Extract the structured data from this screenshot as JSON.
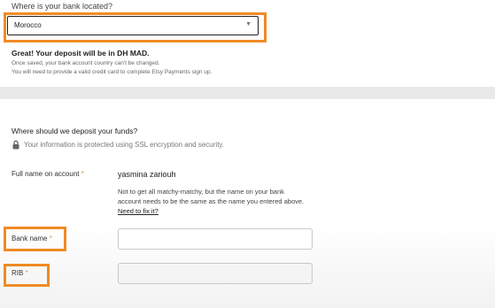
{
  "country": {
    "label": "Where is your bank located?",
    "selected": "Morocco",
    "chevron_icon": "chevron-down-icon"
  },
  "deposit_notice": {
    "headline": "Great! Your deposit will be in DH MAD.",
    "line1": "Once saved, your bank account country can't be changed.",
    "line2": "You will need to provide a valid credit card to complete Etsy Payments sign up."
  },
  "deposit": {
    "title": "Where should we deposit your funds?",
    "security_note": "Your information is protected using SSL encryption and security.",
    "lock_icon": "lock-icon"
  },
  "full_name": {
    "label": "Full name on account",
    "required_mark": "*",
    "value": "yasmina zariouh",
    "hint_line1": "Not to get all matchy-matchy, but the name on your bank",
    "hint_line2": "account needs to be the same as the name you entered above.",
    "fix_link": "Need to fix it?"
  },
  "bank_name": {
    "label": "Bank name",
    "required_mark": "*",
    "value": ""
  },
  "rib": {
    "label": "RIB",
    "required_mark": "*",
    "value": ""
  },
  "colors": {
    "highlight": "#f08a24",
    "background": "#e9e9e9",
    "card": "#ffffff"
  }
}
